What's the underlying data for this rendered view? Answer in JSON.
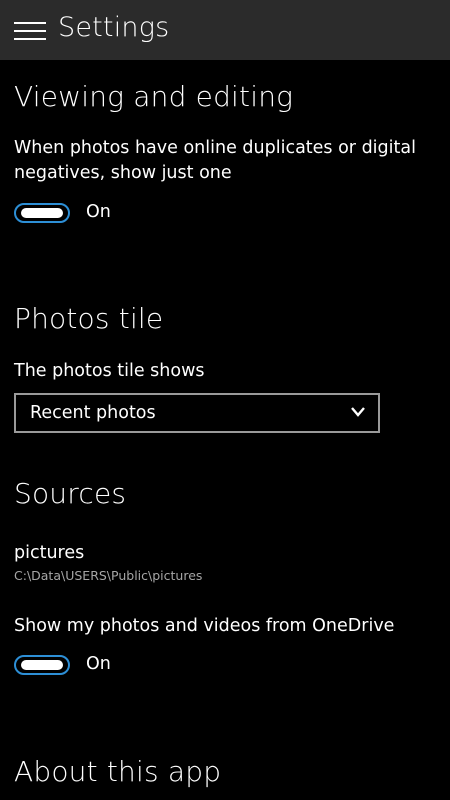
{
  "header": {
    "title": "Settings",
    "menu_icon": "hamburger-menu-icon"
  },
  "viewing_editing": {
    "heading": "Viewing and editing",
    "description_line1": "When photos have online duplicates or digital",
    "description_line2": "negatives, show just one",
    "toggle_state": "On"
  },
  "photos_tile": {
    "heading": "Photos tile",
    "label": "The photos tile shows",
    "selected": "Recent photos"
  },
  "sources": {
    "heading": "Sources",
    "folder_name": "pictures",
    "folder_path": "C:\\Data\\USERS\\Public\\pictures",
    "onedrive_label": "Show my photos and videos from OneDrive",
    "onedrive_toggle_state": "On"
  },
  "about": {
    "heading": "About this app"
  },
  "colors": {
    "accent": "#2d8fd6",
    "background": "#000000",
    "topbar": "#2b2b2b",
    "secondary_text": "#a6a6a6"
  }
}
